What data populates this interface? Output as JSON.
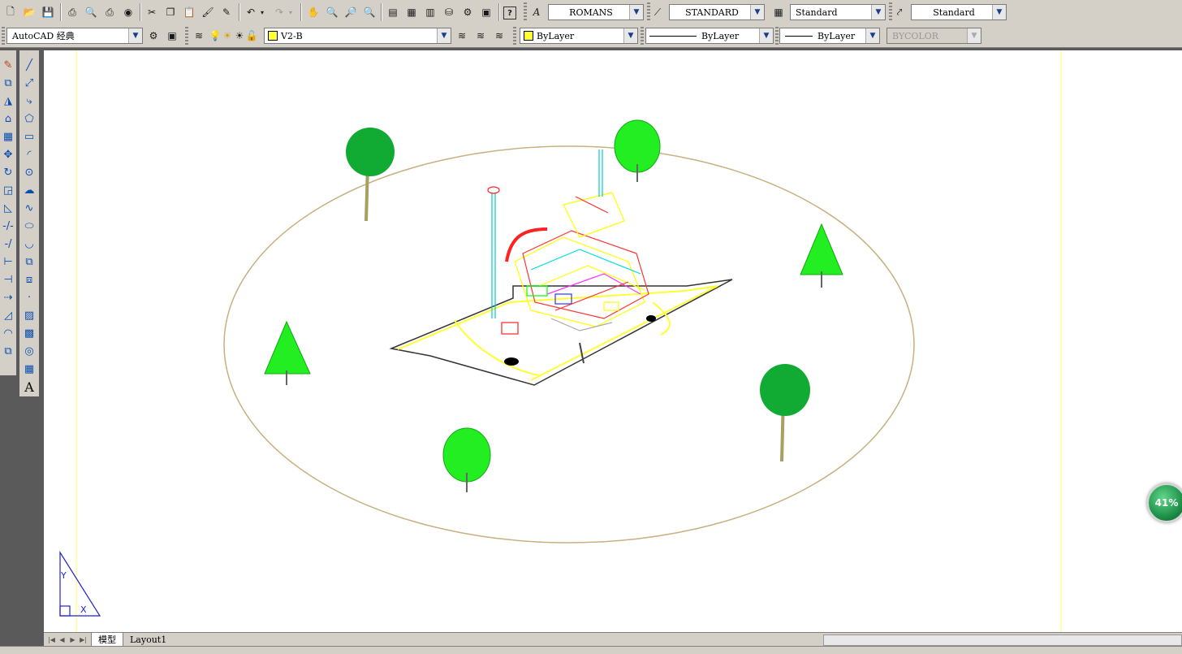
{
  "toolbar_top": {
    "text_style_value": "ROMANS",
    "dim_style_value": "STANDARD",
    "table_style_value": "Standard",
    "multileader_style_value": "Standard"
  },
  "toolbar_second": {
    "workspace_value": "AutoCAD 经典",
    "layer_value": "V2-B",
    "color_value": "ByLayer",
    "linetype_value": "ByLayer",
    "lineweight_value": "ByLayer",
    "plotstyle_value": "BYCOLOR"
  },
  "left_toolbar": {
    "text_tool_glyph": "A"
  },
  "canvas": {
    "ucs_y_label": "Y",
    "ucs_x_label": "X"
  },
  "tabs": [
    {
      "label": "模型"
    },
    {
      "label": "Layout1"
    }
  ],
  "badge": {
    "percent": "41%"
  },
  "colors": {
    "toolbar_bg": "#d4d0c8",
    "canvas_bg": "#ffffff",
    "tree_green": "#22ee22",
    "palm_green": "#11aa33",
    "ellipse_color": "#c8b080",
    "road_yellow": "#ffff33",
    "ucs_blue": "#2222cc"
  }
}
